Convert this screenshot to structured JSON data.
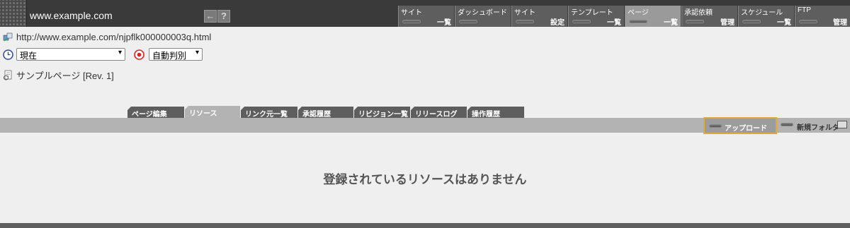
{
  "header": {
    "site_title": "www.example.com",
    "buttons": {
      "back_icon": "←",
      "help_icon": "?"
    },
    "nav": [
      {
        "top": "サイト",
        "bottom": "一覧"
      },
      {
        "top": "ダッシュボード",
        "bottom": ""
      },
      {
        "top": "サイト",
        "bottom": "設定"
      },
      {
        "top": "テンプレート",
        "bottom": "一覧"
      },
      {
        "top": "ページ",
        "bottom": "一覧"
      },
      {
        "top": "承認依頼",
        "bottom": "管理"
      },
      {
        "top": "スケジュール",
        "bottom": "一覧"
      },
      {
        "top": "FTP",
        "bottom": "管理"
      }
    ]
  },
  "page": {
    "url": "http://www.example.com/njpflk000000003q.html",
    "time_select": "現在",
    "mode_select": "自動判別",
    "page_name": "サンプルページ [Rev. 1]"
  },
  "tabs": [
    "ページ編集",
    "リソース",
    "リンク元一覧",
    "承認履歴",
    "リビジョン一覧",
    "リリースログ",
    "操作履歴"
  ],
  "toolbar": {
    "upload": "アップロード",
    "new_folder": "新規フォルダ"
  },
  "empty_message": "登録されているリソースはありません"
}
